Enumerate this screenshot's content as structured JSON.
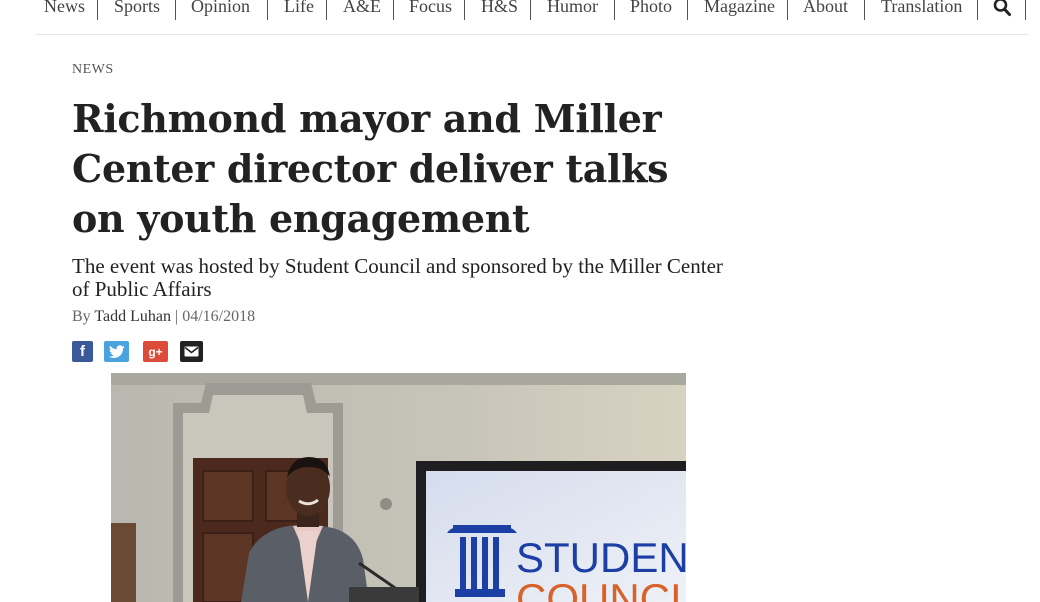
{
  "nav": {
    "items": [
      "News",
      "Sports",
      "Opinion",
      "Life",
      "A&E",
      "Focus",
      "H&S",
      "Humor",
      "Photo",
      "Magazine",
      "About",
      "Translation"
    ],
    "search_icon": "search-icon"
  },
  "article": {
    "section": "NEWS",
    "headline": "Richmond mayor and Miller Center director deliver talks on youth engagement",
    "subhead": "The event was hosted by Student Council and sponsored by the Miller Center of Public Affairs",
    "byline_prefix": "By",
    "author": "Tadd Luhan",
    "separator": "|",
    "date": "04/16/2018"
  },
  "share": {
    "icons": [
      "facebook-icon",
      "twitter-icon",
      "google-plus-icon",
      "email-icon"
    ],
    "facebook_glyph": "f",
    "gplus_glyph": "g+"
  },
  "photo": {
    "screen_line1": "STUDEN",
    "screen_line2": "COUNCI"
  },
  "colors": {
    "facebook": "#3b5998",
    "twitter": "#4aa3df",
    "google_plus": "#dd4b39",
    "email": "#222222",
    "student_council_blue": "#1c3fa6",
    "student_council_orange": "#d9622b"
  }
}
